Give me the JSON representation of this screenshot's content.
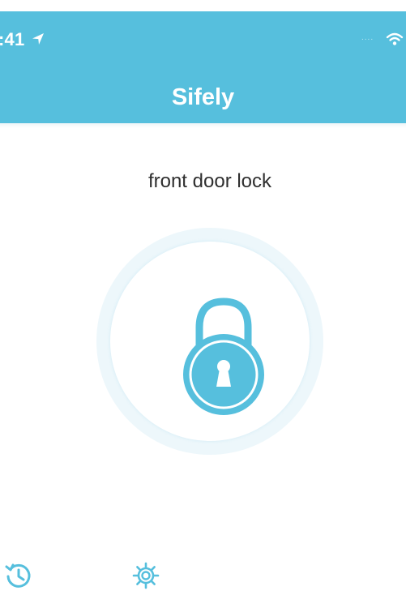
{
  "status_bar": {
    "time": ":41",
    "location_icon": "location-arrow-icon",
    "signal": "....",
    "wifi_icon": "wifi-icon"
  },
  "header": {
    "title": "Sifely"
  },
  "lock": {
    "name": "front door lock",
    "icon": "padlock-icon",
    "accent_color": "#56bfdd"
  },
  "toolbar": {
    "history_icon": "history-icon",
    "settings_icon": "gear-icon"
  }
}
